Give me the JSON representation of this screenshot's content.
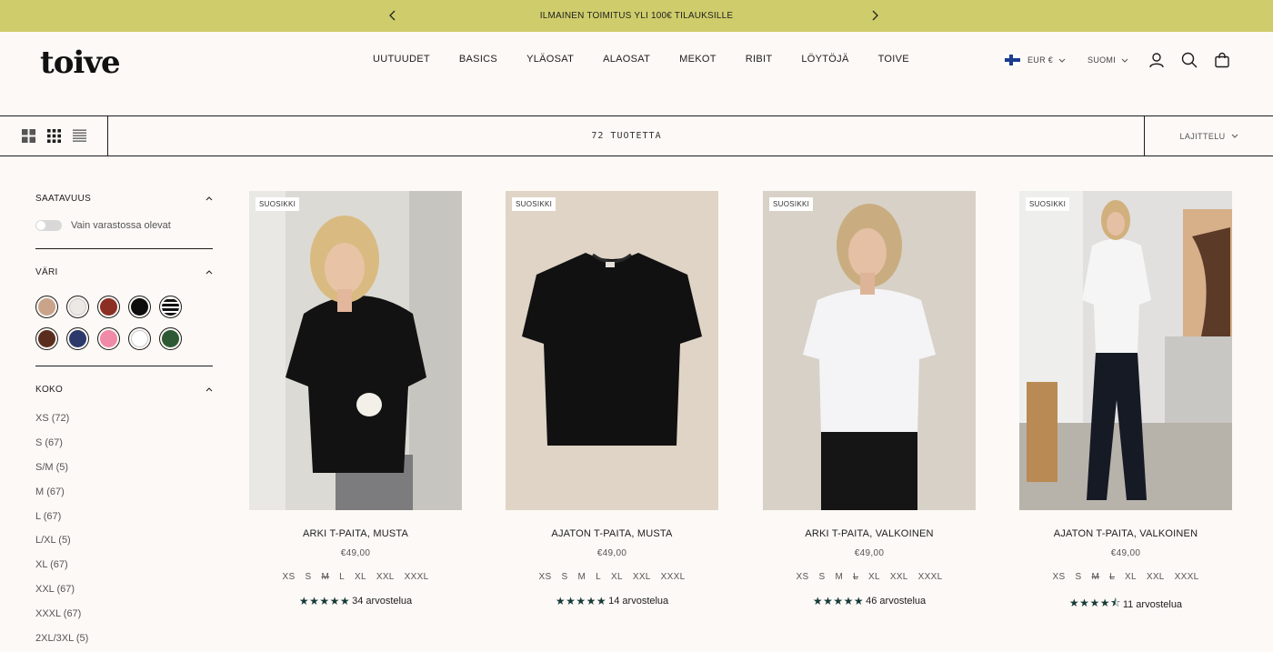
{
  "announcement": {
    "text": "ILMAINEN TOIMITUS YLI 100€ TILAUKSILLE"
  },
  "header": {
    "logo": "toive",
    "nav": [
      "UUTUUDET",
      "BASICS",
      "YLÄOSAT",
      "ALAOSAT",
      "MEKOT",
      "RIBIT",
      "LÖYTÖJÄ",
      "TOIVE"
    ],
    "currency": "EUR €",
    "language": "SUOMI"
  },
  "toolbar": {
    "count": "72 TUOTETTA",
    "sort_label": "LAJITTELU"
  },
  "filters": {
    "availability": {
      "title": "SAATAVUUS",
      "toggle_label": "Vain varastossa olevat"
    },
    "color": {
      "title": "VÄRI",
      "swatches": [
        "#c9a48a",
        "#ece9e4",
        "#8b2f24",
        "#0d0d0d",
        "stripes",
        "#5a2e1f",
        "#2b3a6b",
        "#f08aa6",
        "#ffffff",
        "#2d5a34"
      ]
    },
    "size": {
      "title": "KOKO",
      "items": [
        "XS (72)",
        "S (67)",
        "S/M (5)",
        "M (67)",
        "L (67)",
        "L/XL (5)",
        "XL (67)",
        "XXL (67)",
        "XXXL (67)",
        "2XL/3XL (5)"
      ]
    }
  },
  "products": [
    {
      "badge": "SUOSIKKI",
      "name": "ARKI T-PAITA, MUSTA",
      "price": "€49,00",
      "sizes": [
        "XS",
        "S",
        "M",
        "L",
        "XL",
        "XXL",
        "XXXL"
      ],
      "sold_out": [
        2
      ],
      "rating": 5,
      "reviews": "34 arvostelua"
    },
    {
      "badge": "SUOSIKKI",
      "name": "AJATON T-PAITA, MUSTA",
      "price": "€49,00",
      "sizes": [
        "XS",
        "S",
        "M",
        "L",
        "XL",
        "XXL",
        "XXXL"
      ],
      "sold_out": [],
      "rating": 5,
      "reviews": "14 arvostelua"
    },
    {
      "badge": "SUOSIKKI",
      "name": "ARKI T-PAITA, VALKOINEN",
      "price": "€49,00",
      "sizes": [
        "XS",
        "S",
        "M",
        "L",
        "XL",
        "XXL",
        "XXXL"
      ],
      "sold_out": [
        3
      ],
      "rating": 5,
      "reviews": "46 arvostelua"
    },
    {
      "badge": "SUOSIKKI",
      "name": "AJATON T-PAITA, VALKOINEN",
      "price": "€49,00",
      "sizes": [
        "XS",
        "S",
        "M",
        "L",
        "XL",
        "XXL",
        "XXXL"
      ],
      "sold_out": [
        2,
        3
      ],
      "rating": 4.5,
      "reviews": "11 arvostelua"
    }
  ]
}
